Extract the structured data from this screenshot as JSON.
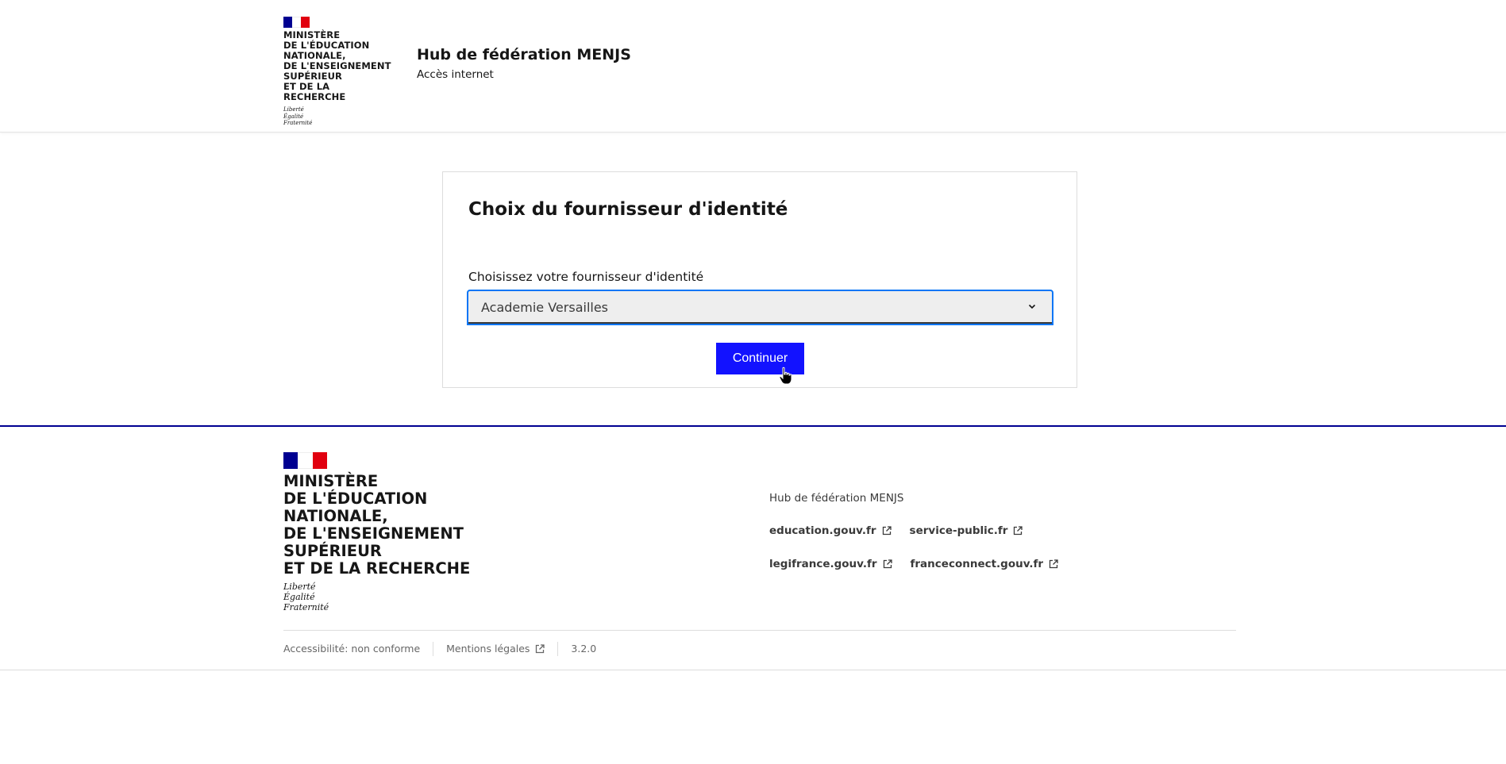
{
  "header": {
    "ministry": "MINISTÈRE\nDE L'ÉDUCATION\nNATIONALE,\nDE L'ENSEIGNEMENT\nSUPÉRIEUR\nET DE LA RECHERCHE",
    "motto": "Liberté\nÉgalité\nFraternité",
    "service_title": "Hub de fédération MENJS",
    "service_tagline": "Accès internet"
  },
  "form": {
    "title": "Choix du fournisseur d'identité",
    "select_label": "Choisissez votre fournisseur d'identité",
    "select_value": "Academie Versailles",
    "submit_label": "Continuer"
  },
  "footer": {
    "ministry": "MINISTÈRE\nDE L'ÉDUCATION\nNATIONALE,\nDE L'ENSEIGNEMENT\nSUPÉRIEUR\nET DE LA RECHERCHE",
    "motto": "Liberté\nÉgalité\nFraternité",
    "title": "Hub de fédération MENJS",
    "links": [
      "education.gouv.fr",
      "service-public.fr",
      "legifrance.gouv.fr",
      "franceconnect.gouv.fr"
    ],
    "accessibility": "Accessibilité: non conforme",
    "legal": "Mentions légales",
    "version": "3.2.0"
  },
  "colors": {
    "primary": "#1212ff",
    "navy": "#000091",
    "red": "#e1000f",
    "focus": "#0a76f6"
  }
}
